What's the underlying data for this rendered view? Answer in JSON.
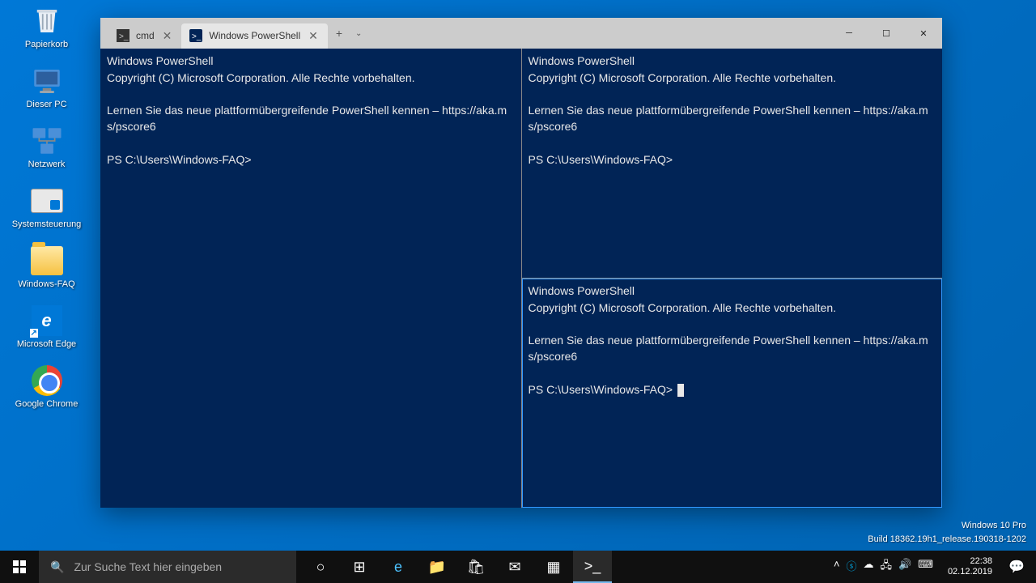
{
  "desktop": {
    "icons": [
      {
        "label": "Papierkorb"
      },
      {
        "label": "Dieser PC"
      },
      {
        "label": "Netzwerk"
      },
      {
        "label": "Systemsteuerung"
      },
      {
        "label": "Windows-FAQ"
      },
      {
        "label": "Microsoft Edge"
      },
      {
        "label": "Google Chrome"
      }
    ]
  },
  "window": {
    "tabs": [
      {
        "label": "cmd"
      },
      {
        "label": "Windows PowerShell"
      }
    ]
  },
  "terminal": {
    "line1": "Windows PowerShell",
    "line2": "Copyright (C) Microsoft Corporation. Alle Rechte vorbehalten.",
    "line3": "Lernen Sie das neue plattformübergreifende PowerShell kennen – https://aka.ms/pscore6",
    "prompt": "PS C:\\Users\\Windows-FAQ>"
  },
  "watermark": {
    "line1": "Windows 10 Pro",
    "line2": "Build 18362.19h1_release.190318-1202"
  },
  "taskbar": {
    "search_placeholder": "Zur Suche Text hier eingeben"
  },
  "clock": {
    "time": "22:38",
    "date": "02.12.2019"
  }
}
